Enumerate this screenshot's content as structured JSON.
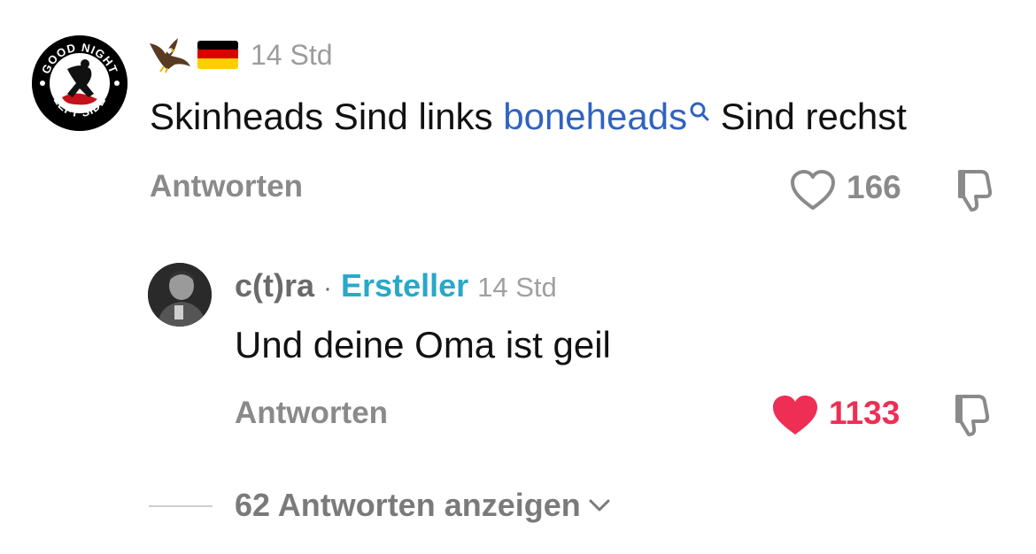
{
  "main_comment": {
    "avatar_icon": "good-night-left-side-logo",
    "avatar_text_top": "GOOD NIGHT",
    "avatar_text_bottom": "LEFT SIDE",
    "username_emojis": [
      "eagle-icon",
      "germany-flag-icon"
    ],
    "time": "14 Std",
    "text_before": "Skinheads Sind links ",
    "link_text": "boneheads",
    "text_after": " Sind rechst",
    "reply_label": "Antworten",
    "like_count": "166",
    "liked": false
  },
  "reply_comment": {
    "avatar_icon": "user-photo-avatar",
    "author": "c(t)ra",
    "separator": "·",
    "creator_badge": "Ersteller",
    "time": "14 Std",
    "text": "Und deine Oma ist geil",
    "reply_label": "Antworten",
    "like_count": "1133",
    "liked": true
  },
  "show_replies": {
    "label": "62 Antworten anzeigen"
  },
  "colors": {
    "link": "#2f63c1",
    "creator": "#2aa8c9",
    "liked": "#ee2e55",
    "muted": "#8a8a8a"
  }
}
